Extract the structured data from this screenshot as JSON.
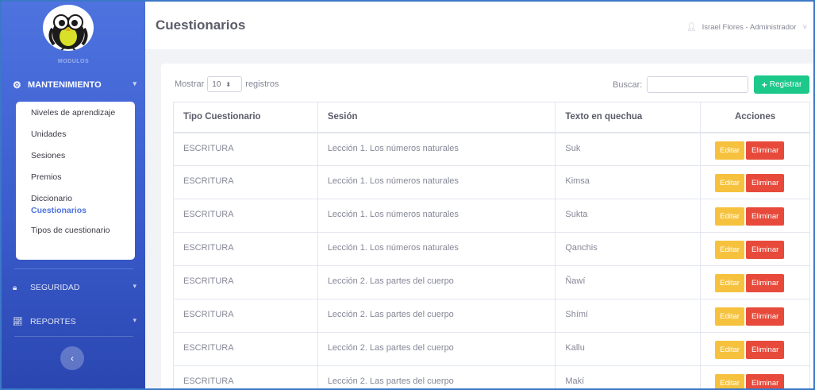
{
  "sidebar": {
    "section_label": "MODULOS",
    "mantenimiento_label": "MANTENIMIENTO",
    "submenu": [
      {
        "label": "Niveles de aprendizaje"
      },
      {
        "label": "Unidades"
      },
      {
        "label": "Sesiones"
      },
      {
        "label": "Premios"
      },
      {
        "label": "Diccionario"
      },
      {
        "label": "Cuestionarios"
      },
      {
        "label": "Tipos de cuestionario"
      }
    ],
    "seguridad_label": "SEGURIDAD",
    "reportes_label": "REPORTES"
  },
  "header": {
    "title": "Cuestionarios",
    "user": "Israel Flores - Administrador"
  },
  "controls": {
    "show_prefix": "Mostrar",
    "show_value": "10",
    "show_suffix": "registros",
    "search_label": "Buscar:",
    "search_value": "",
    "register_label": "Registrar"
  },
  "table": {
    "columns": [
      "Tipo Cuestionario",
      "Sesión",
      "Texto en quechua",
      "Acciones"
    ],
    "rows": [
      [
        "ESCRITURA",
        "Lección 1. Los números naturales",
        "Suk"
      ],
      [
        "ESCRITURA",
        "Lección 1. Los números naturales",
        "Kimsa"
      ],
      [
        "ESCRITURA",
        "Lección 1. Los números naturales",
        "Sukta"
      ],
      [
        "ESCRITURA",
        "Lección 1. Los números naturales",
        "Qanchis"
      ],
      [
        "ESCRITURA",
        "Lección 2. Las partes del cuerpo",
        "Ñawí"
      ],
      [
        "ESCRITURA",
        "Lección 2. Las partes del cuerpo",
        "Shímí"
      ],
      [
        "ESCRITURA",
        "Lección 2. Las partes del cuerpo",
        "Kallu"
      ],
      [
        "ESCRITURA",
        "Lección 2. Las partes del cuerpo",
        "Makí"
      ]
    ],
    "edit_label": "Editar",
    "delete_label": "Eliminar"
  },
  "colors": {
    "sidebar": "#4e73df",
    "edit": "#f6c23e",
    "delete": "#e74a3b",
    "register": "#1cc88a"
  }
}
